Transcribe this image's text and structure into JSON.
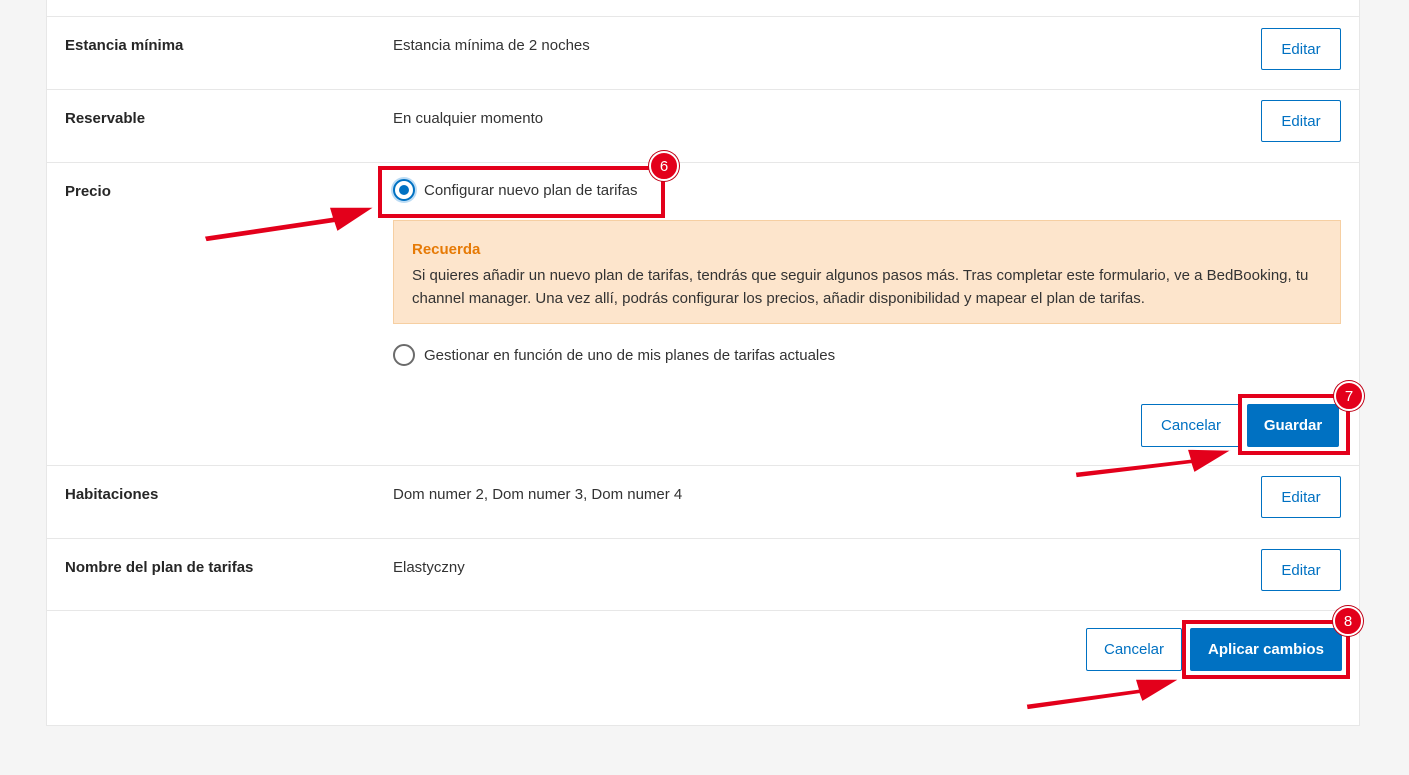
{
  "rows": {
    "min_stay": {
      "label": "Estancia mínima",
      "value": "Estancia mínima de 2 noches",
      "edit": "Editar"
    },
    "bookable": {
      "label": "Reservable",
      "value": "En cualquier momento",
      "edit": "Editar"
    },
    "price": {
      "label": "Precio",
      "option_new": "Configurar nuevo plan de tarifas",
      "option_existing": "Gestionar en función de uno de mis planes de tarifas actuales",
      "notice_title": "Recuerda",
      "notice_body": "Si quieres añadir un nuevo plan de tarifas, tendrás que seguir algunos pasos más. Tras completar este formulario, ve a BedBooking, tu channel manager. Una vez allí, podrás configurar los precios, añadir disponibilidad y mapear el plan de tarifas.",
      "cancel": "Cancelar",
      "save": "Guardar"
    },
    "rooms": {
      "label": "Habitaciones",
      "value": "Dom numer 2, Dom numer 3, Dom numer 4",
      "edit": "Editar"
    },
    "plan_name": {
      "label": "Nombre del plan de tarifas",
      "value": "Elastyczny",
      "edit": "Editar"
    }
  },
  "footer": {
    "cancel": "Cancelar",
    "apply": "Aplicar cambios"
  },
  "annotations": {
    "step_6": "6",
    "step_7": "7",
    "step_8": "8"
  },
  "colors": {
    "brand_blue": "#0071c2",
    "highlight_red": "#e3001b",
    "notice_bg": "#fde5cc",
    "notice_title": "#e67a06"
  }
}
